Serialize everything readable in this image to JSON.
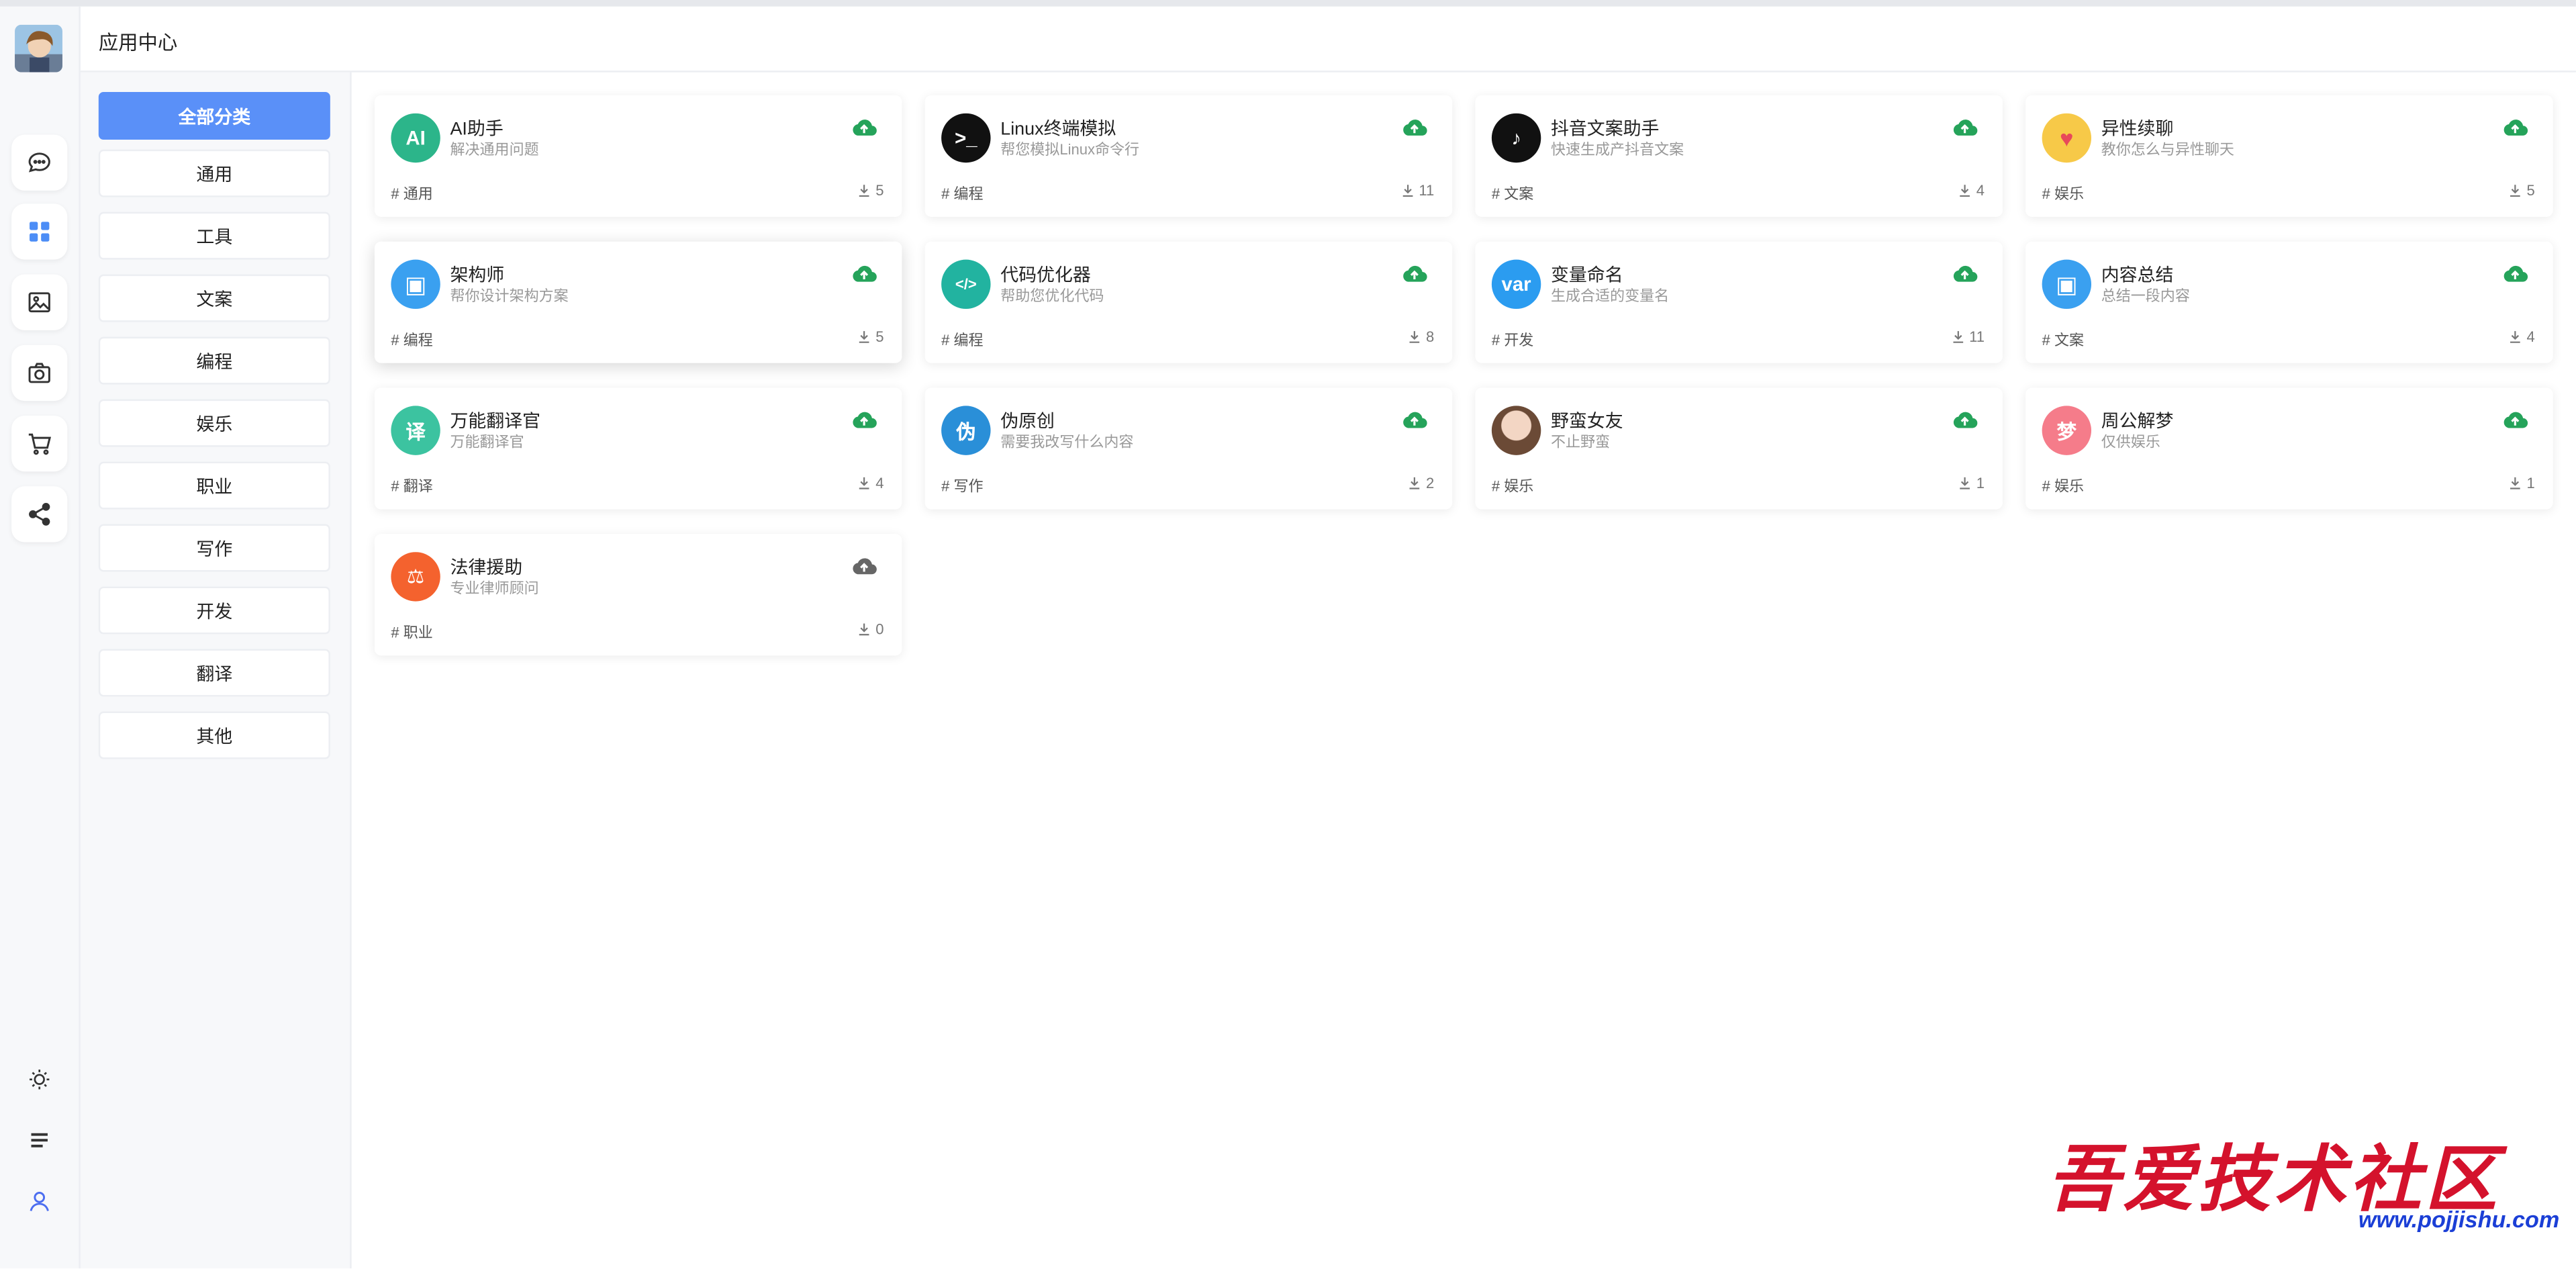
{
  "header": {
    "title": "应用中心"
  },
  "rail": {
    "top_icons": [
      "chat-icon",
      "apps-grid-icon",
      "image-icon",
      "camera-icon",
      "cart-icon",
      "share-icon"
    ],
    "bottom_icons": [
      "sun-icon",
      "menu-icon",
      "user-icon"
    ],
    "active_color": "#4c8df6"
  },
  "categories": [
    "全部分类",
    "通用",
    "工具",
    "文案",
    "编程",
    "娱乐",
    "职业",
    "写作",
    "开发",
    "翻译",
    "其他"
  ],
  "active_category": "全部分类",
  "apps": [
    {
      "name": "AI助手",
      "desc": "解决通用问题",
      "tag": "# 通用",
      "count": "5",
      "icon": "AI",
      "color": "#2cb58a",
      "cloud": "#25a35a"
    },
    {
      "name": "Linux终端模拟",
      "desc": "帮您模拟Linux命令行",
      "tag": "# 编程",
      "count": "11",
      "icon": ">_",
      "color": "#111111",
      "cloud": "#25a35a"
    },
    {
      "name": "抖音文案助手",
      "desc": "快速生成产抖音文案",
      "tag": "# 文案",
      "count": "4",
      "icon": "♪",
      "color": "#111111",
      "cloud": "#25a35a"
    },
    {
      "name": "异性续聊",
      "desc": "教你怎么与异性聊天",
      "tag": "# 娱乐",
      "count": "5",
      "icon": "♥",
      "color": "#f7c948",
      "cloud": "#25a35a"
    },
    {
      "name": "架构师",
      "desc": "帮你设计架构方案",
      "tag": "# 编程",
      "count": "5",
      "icon": "▣",
      "color": "#3aa0f0",
      "cloud": "#25a35a"
    },
    {
      "name": "代码优化器",
      "desc": "帮助您优化代码",
      "tag": "# 编程",
      "count": "8",
      "icon": "</>",
      "color": "#22b3a0",
      "cloud": "#25a35a"
    },
    {
      "name": "变量命名",
      "desc": "生成合适的变量名",
      "tag": "# 开发",
      "count": "11",
      "icon": "var",
      "color": "#2b9cf0",
      "cloud": "#25a35a"
    },
    {
      "name": "内容总结",
      "desc": "总结一段内容",
      "tag": "# 文案",
      "count": "4",
      "icon": "▣",
      "color": "#3aa0f0",
      "cloud": "#25a35a"
    },
    {
      "name": "万能翻译官",
      "desc": "万能翻译官",
      "tag": "# 翻译",
      "count": "4",
      "icon": "译",
      "color": "#3cc3a0",
      "cloud": "#25a35a"
    },
    {
      "name": "伪原创",
      "desc": "需要我改写什么内容",
      "tag": "# 写作",
      "count": "2",
      "icon": "伪",
      "color": "#2a8fd8",
      "cloud": "#25a35a"
    },
    {
      "name": "野蛮女友",
      "desc": "不止野蛮",
      "tag": "# 娱乐",
      "count": "1",
      "icon": "",
      "color": "#c99a80",
      "cloud": "#25a35a"
    },
    {
      "name": "周公解梦",
      "desc": "仅供娱乐",
      "tag": "# 娱乐",
      "count": "1",
      "icon": "梦",
      "color": "#f57c8a",
      "cloud": "#25a35a"
    },
    {
      "name": "法律援助",
      "desc": "专业律师顾问",
      "tag": "# 职业",
      "count": "0",
      "icon": "⚖",
      "color": "#f4622e",
      "cloud": "#666666"
    }
  ],
  "watermark": {
    "text": "吾爱技术社区",
    "url": "www.pojjishu.com"
  }
}
